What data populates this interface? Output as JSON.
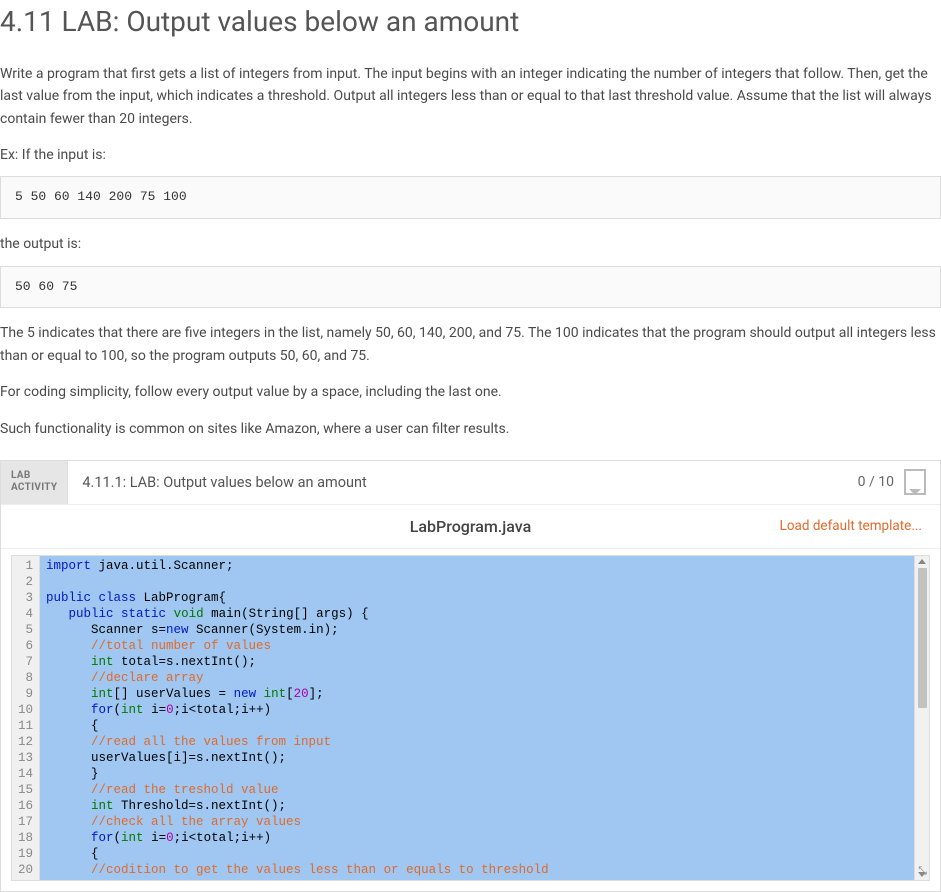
{
  "title": "4.11 LAB: Output values below an amount",
  "desc1": "Write a program that first gets a list of integers from input. The input begins with an integer indicating the number of integers that follow. Then, get the last value from the input, which indicates a threshold. Output all integers less than or equal to that last threshold value. Assume that the list will always contain fewer than 20 integers.",
  "ex_if_input": "Ex: If the input is:",
  "input_example": "5 50 60 140 200 75 100",
  "output_is": "the output is:",
  "output_example": "50 60 75",
  "desc2": "The 5 indicates that there are five integers in the list, namely 50, 60, 140, 200, and 75. The 100 indicates that the program should output all integers less than or equal to 100, so the program outputs 50, 60, and 75.",
  "desc3": "For coding simplicity, follow every output value by a space, including the last one.",
  "desc4": "Such functionality is common on sites like Amazon, where a user can filter results.",
  "lab_badge_line1": "LAB",
  "lab_badge_line2": "ACTIVITY",
  "lab_title": "4.11.1: LAB: Output values below an amount",
  "lab_score": "0 / 10",
  "file_name": "LabProgram.java",
  "load_template": "Load default template...",
  "code_lines": [
    {
      "n": 1,
      "segs": [
        {
          "c": "kw-blue",
          "t": "import"
        },
        {
          "t": " java.util.Scanner;"
        }
      ]
    },
    {
      "n": 2,
      "segs": []
    },
    {
      "n": 3,
      "segs": [
        {
          "c": "kw-blue",
          "t": "public"
        },
        {
          "t": " "
        },
        {
          "c": "kw-blue",
          "t": "class"
        },
        {
          "t": " LabProgram{"
        }
      ]
    },
    {
      "n": 4,
      "segs": [
        {
          "t": "   "
        },
        {
          "c": "kw-blue",
          "t": "public"
        },
        {
          "t": " "
        },
        {
          "c": "kw-blue",
          "t": "static"
        },
        {
          "t": " "
        },
        {
          "c": "kw-green",
          "t": "void"
        },
        {
          "t": " main(String[] args) {"
        }
      ]
    },
    {
      "n": 5,
      "segs": [
        {
          "t": "      Scanner s="
        },
        {
          "c": "kw-blue",
          "t": "new"
        },
        {
          "t": " Scanner(System.in);"
        }
      ]
    },
    {
      "n": 6,
      "segs": [
        {
          "t": "      "
        },
        {
          "c": "kw-comment",
          "t": "//total number of values"
        }
      ]
    },
    {
      "n": 7,
      "segs": [
        {
          "t": "      "
        },
        {
          "c": "kw-green",
          "t": "int"
        },
        {
          "t": " total=s.nextInt();"
        }
      ]
    },
    {
      "n": 8,
      "segs": [
        {
          "t": "      "
        },
        {
          "c": "kw-comment",
          "t": "//declare array"
        }
      ]
    },
    {
      "n": 9,
      "segs": [
        {
          "t": "      "
        },
        {
          "c": "kw-green",
          "t": "int"
        },
        {
          "t": "[] userValues = "
        },
        {
          "c": "kw-blue",
          "t": "new"
        },
        {
          "t": " "
        },
        {
          "c": "kw-green",
          "t": "int"
        },
        {
          "t": "["
        },
        {
          "c": "kw-num",
          "t": "20"
        },
        {
          "t": "];"
        }
      ]
    },
    {
      "n": 10,
      "segs": [
        {
          "t": "      "
        },
        {
          "c": "kw-blue",
          "t": "for"
        },
        {
          "t": "("
        },
        {
          "c": "kw-green",
          "t": "int"
        },
        {
          "t": " i="
        },
        {
          "c": "kw-num",
          "t": "0"
        },
        {
          "t": ";i<total;i++)"
        }
      ]
    },
    {
      "n": 11,
      "segs": [
        {
          "t": "      {"
        }
      ]
    },
    {
      "n": 12,
      "segs": [
        {
          "t": "      "
        },
        {
          "c": "kw-comment",
          "t": "//read all the values from input"
        }
      ]
    },
    {
      "n": 13,
      "segs": [
        {
          "t": "      userValues[i]=s.nextInt();"
        }
      ]
    },
    {
      "n": 14,
      "segs": [
        {
          "t": "      }"
        }
      ]
    },
    {
      "n": 15,
      "segs": [
        {
          "t": "      "
        },
        {
          "c": "kw-comment",
          "t": "//read the treshold value"
        }
      ]
    },
    {
      "n": 16,
      "segs": [
        {
          "t": "      "
        },
        {
          "c": "kw-green",
          "t": "int"
        },
        {
          "t": " Threshold=s.nextInt();"
        }
      ]
    },
    {
      "n": 17,
      "segs": [
        {
          "t": "      "
        },
        {
          "c": "kw-comment",
          "t": "//check all the array values"
        }
      ]
    },
    {
      "n": 18,
      "segs": [
        {
          "t": "      "
        },
        {
          "c": "kw-blue",
          "t": "for"
        },
        {
          "t": "("
        },
        {
          "c": "kw-green",
          "t": "int"
        },
        {
          "t": " i="
        },
        {
          "c": "kw-num",
          "t": "0"
        },
        {
          "t": ";i<total;i++)"
        }
      ]
    },
    {
      "n": 19,
      "segs": [
        {
          "t": "      {"
        }
      ]
    },
    {
      "n": 20,
      "segs": [
        {
          "t": "      "
        },
        {
          "c": "kw-comment",
          "t": "//codition to get the values less than or equals to threshold"
        }
      ]
    }
  ]
}
